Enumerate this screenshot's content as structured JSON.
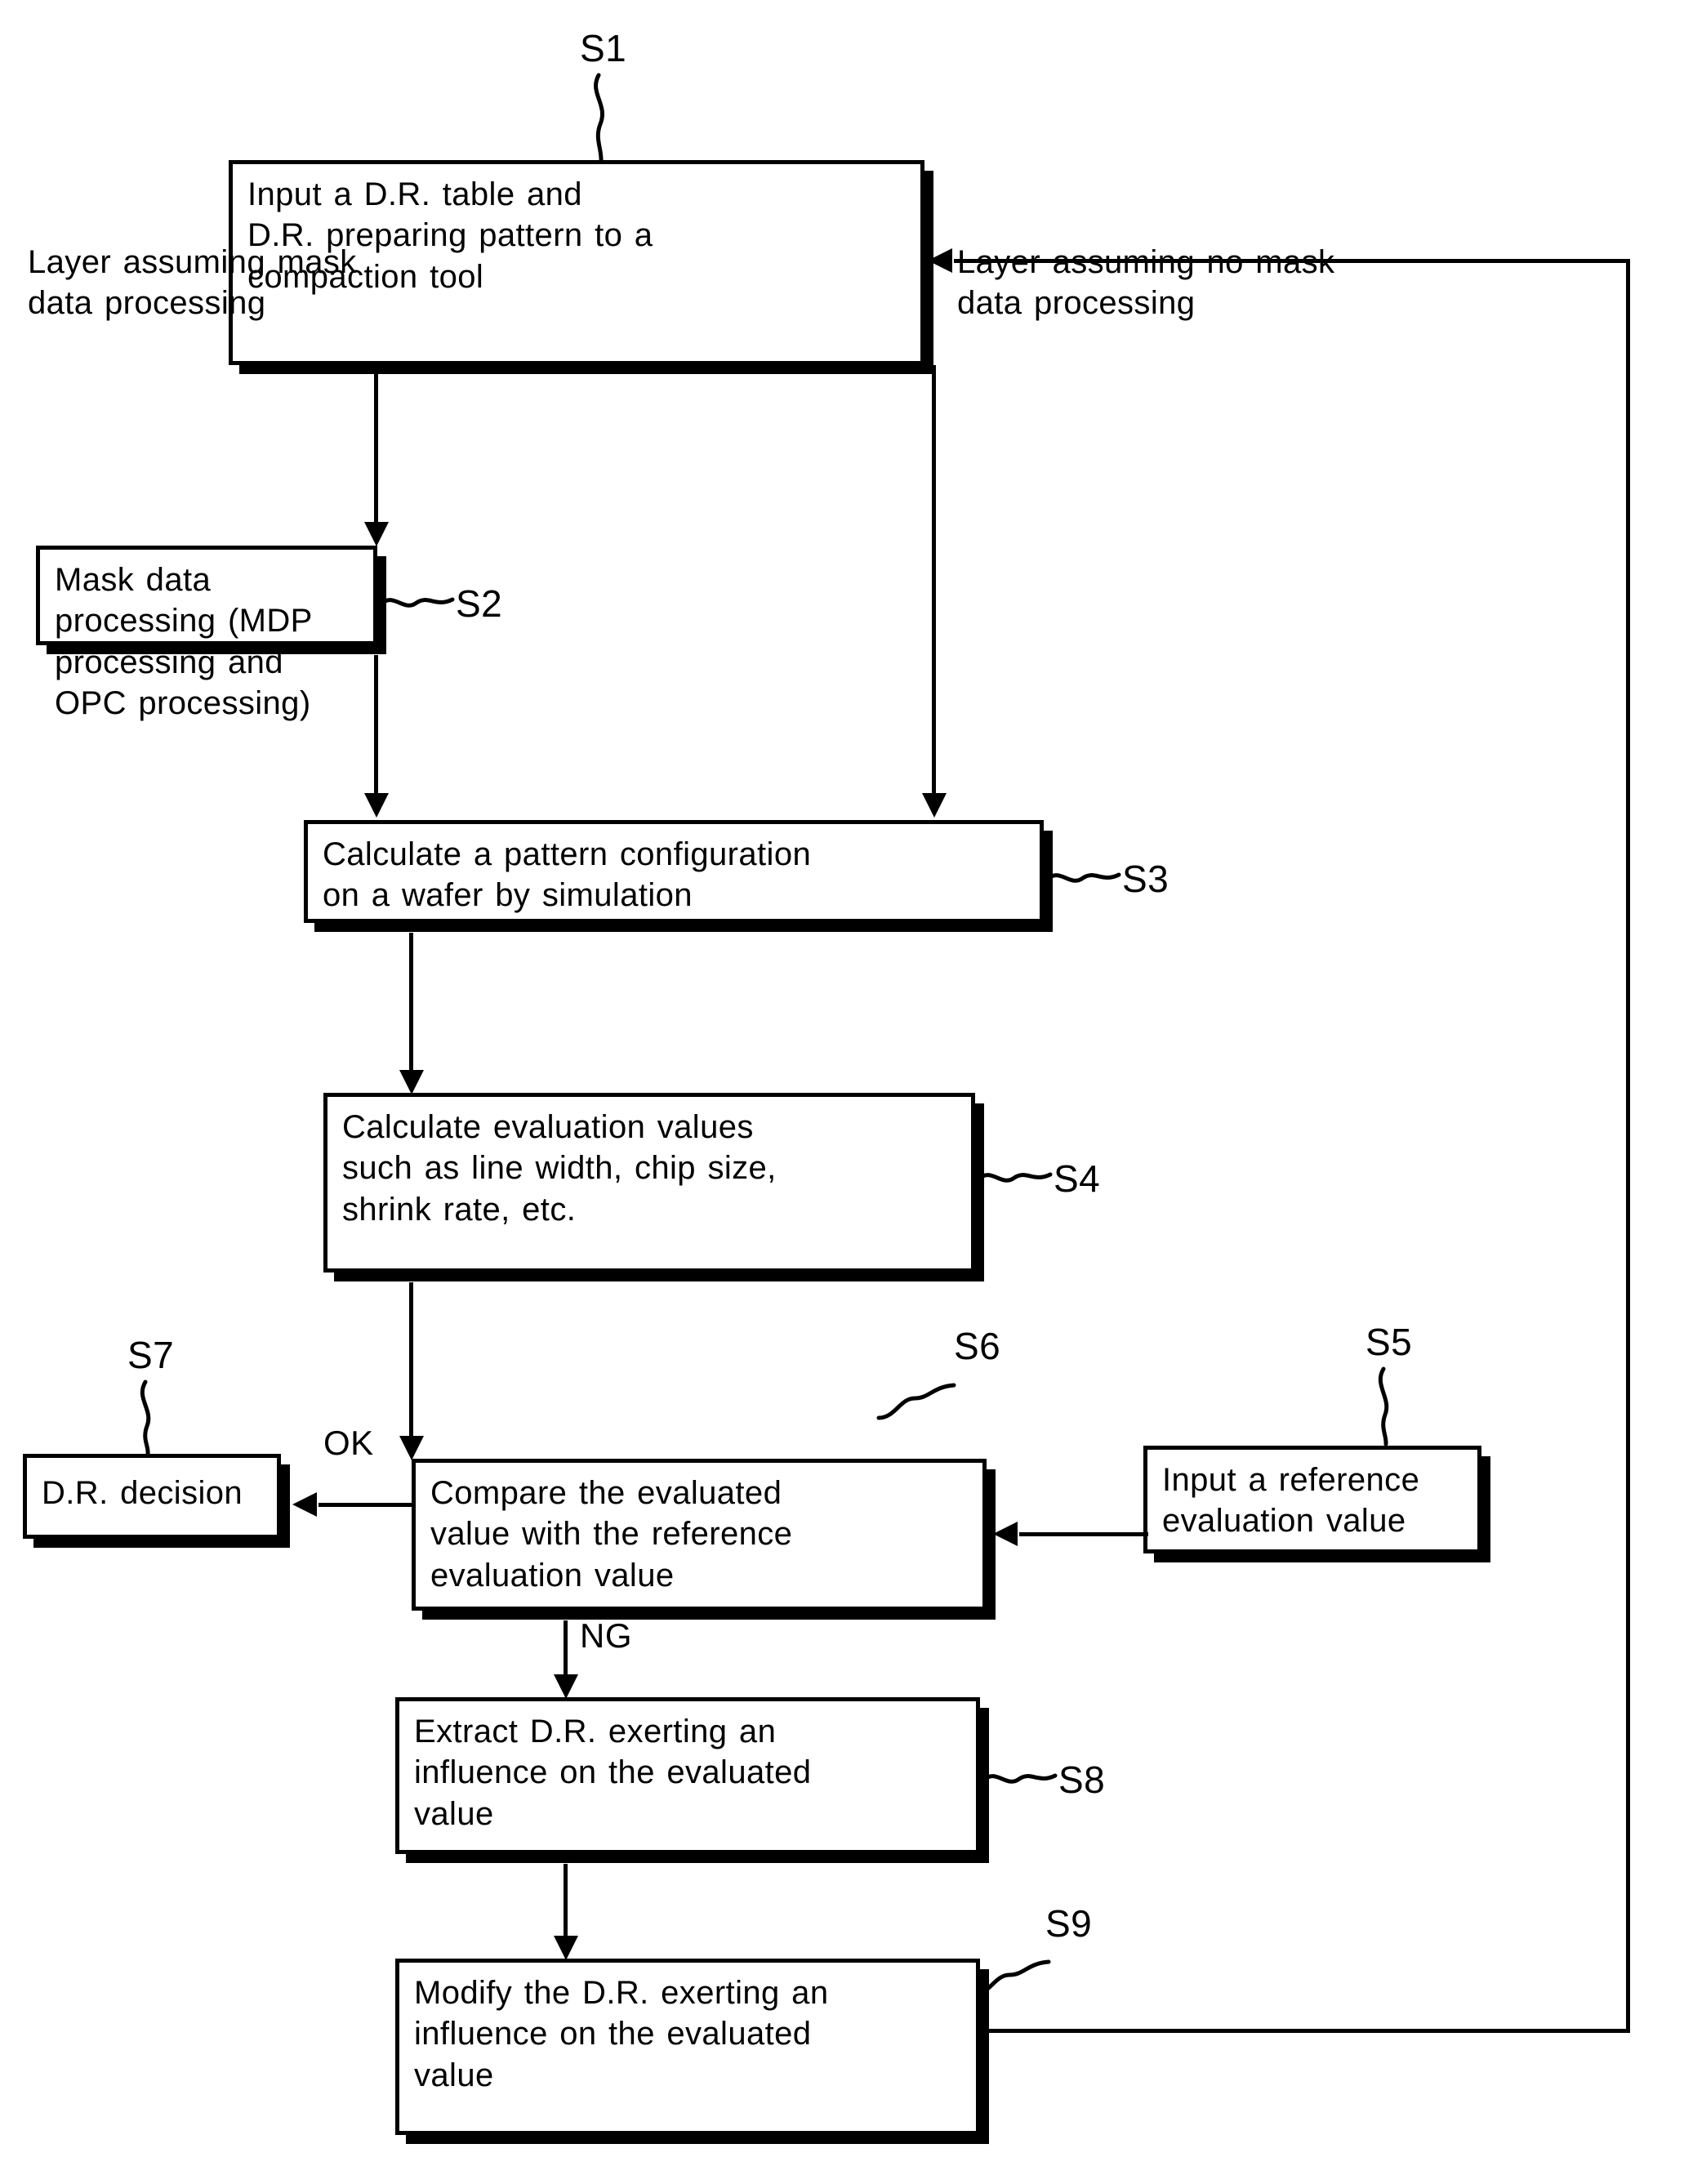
{
  "figure": {
    "type": "flowchart",
    "orientation": "vertical",
    "line_color": "#000000",
    "background_color": "#ffffff"
  },
  "steps": {
    "s1": {
      "tag": "S1",
      "text": "Input a D.R. table and\nD.R. preparing pattern to a\ncompaction tool"
    },
    "s2": {
      "tag": "S2",
      "text": "Mask data processing (MDP\nprocessing and OPC processing)"
    },
    "s3": {
      "tag": "S3",
      "text": "Calculate a pattern configuration\non a wafer by simulation"
    },
    "s4": {
      "tag": "S4",
      "text": "Calculate evaluation values\nsuch as line width, chip size,\nshrink rate, etc."
    },
    "s5": {
      "tag": "S5",
      "text": "Input a reference\nevaluation value"
    },
    "s6": {
      "tag": "S6",
      "text": "Compare the evaluated\nvalue with the reference\nevaluation value"
    },
    "s7": {
      "tag": "S7",
      "text": "D.R. decision"
    },
    "s8": {
      "tag": "S8",
      "text": "Extract D.R. exerting an\ninfluence on the evaluated\nvalue"
    },
    "s9": {
      "tag": "S9",
      "text": "Modify the D.R. exerting an\ninfluence on the evaluated\nvalue"
    }
  },
  "branch_labels": {
    "left_branch": "Layer assuming mask\ndata processing",
    "right_branch": "Layer assuming no mask\ndata processing"
  },
  "edge_labels": {
    "ok": "OK",
    "ng": "NG"
  }
}
